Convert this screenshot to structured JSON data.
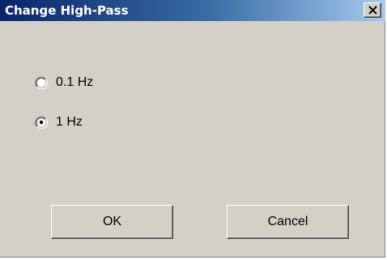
{
  "window": {
    "title": "Change High-Pass"
  },
  "options": [
    {
      "label": "0.1 Hz",
      "selected": false
    },
    {
      "label": "1 Hz",
      "selected": true
    }
  ],
  "buttons": {
    "ok_label": "OK",
    "cancel_label": "Cancel"
  },
  "icons": {
    "close": "close-icon",
    "radio_unselected": "radio-unselected-icon",
    "radio_selected": "radio-selected-icon"
  },
  "colors": {
    "titlebar_start": "#0a246a",
    "titlebar_end": "#a6caf0",
    "dialog_background": "#d4d0c8"
  }
}
